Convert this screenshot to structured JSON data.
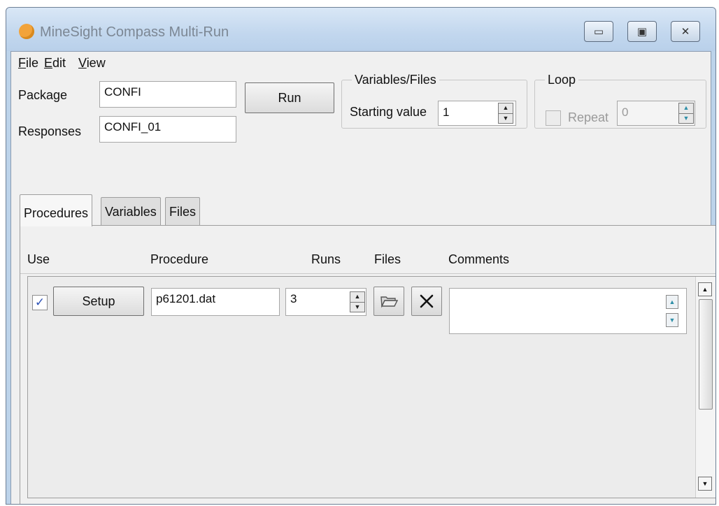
{
  "window": {
    "title": "MineSight Compass Multi-Run",
    "icon": "app-hexagon-icon",
    "controls": [
      "minimize-icon",
      "maximize-icon",
      "close-icon"
    ],
    "control_glyphs": {
      "minimize": "▭",
      "maximize": "▣",
      "close": "✕"
    }
  },
  "menu": {
    "file": "File",
    "edit": "Edit",
    "view": "View"
  },
  "form": {
    "package_label": "Package",
    "package_value": "CONFI",
    "responses_label": "Responses",
    "responses_value": "CONFI_01",
    "run_label": "Run"
  },
  "variables_files": {
    "legend": "Variables/Files",
    "starting_value_label": "Starting value",
    "starting_value": "1"
  },
  "loop": {
    "legend": "Loop",
    "repeat_label": "Repeat",
    "repeat_checked": false,
    "repeat_value": "0",
    "enabled": false
  },
  "tabs": [
    {
      "label": "Procedures",
      "active": true
    },
    {
      "label": "Variables",
      "active": false
    },
    {
      "label": "Files",
      "active": false
    }
  ],
  "table": {
    "headers": {
      "use": "Use",
      "procedure": "Procedure",
      "runs": "Runs",
      "files": "Files",
      "comments": "Comments"
    },
    "rows": [
      {
        "use_checked": true,
        "check_glyph": "✓",
        "setup_label": "Setup",
        "procedure": "p61201.dat",
        "runs": "3",
        "files_icons": [
          "folder-icon",
          "delete-x-icon"
        ],
        "comments": ""
      }
    ]
  },
  "colors": {
    "title_bar": "#c2d7ee",
    "client_bg": "#f0f0f0",
    "app_icon": "#f2a33a",
    "check_mark": "#2d52b6",
    "spin_arrow_accent": "#2e8fa8"
  }
}
